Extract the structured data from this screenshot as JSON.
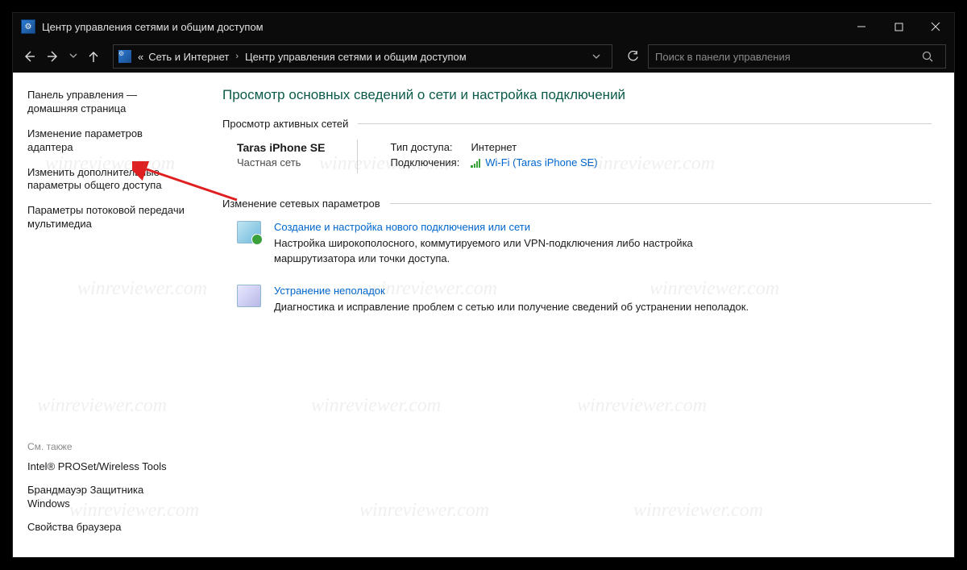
{
  "window": {
    "title": "Центр управления сетями и общим доступом"
  },
  "address": {
    "prefix": "«",
    "crumb1": "Сеть и Интернет",
    "crumb2": "Центр управления сетями и общим доступом"
  },
  "search": {
    "placeholder": "Поиск в панели управления"
  },
  "sidebar": {
    "home": "Панель управления — домашняя страница",
    "adapter": "Изменение параметров адаптера",
    "sharing": "Изменить дополнительные параметры общего доступа",
    "streaming": "Параметры потоковой передачи мультимедиа",
    "see_also_hdr": "См. также",
    "see_also_1": "Intel® PROSet/Wireless Tools",
    "see_also_2": "Брандмауэр Защитника Windows",
    "see_also_3": "Свойства браузера"
  },
  "main": {
    "heading": "Просмотр основных сведений о сети и настройка подключений",
    "view_active_hdr": "Просмотр активных сетей",
    "net": {
      "name": "Taras iPhone SE",
      "type": "Частная сеть",
      "access_label": "Тип доступа:",
      "access_value": "Интернет",
      "conn_label": "Подключения:",
      "conn_value": "Wi-Fi (Taras iPhone SE)"
    },
    "change_hdr": "Изменение сетевых параметров",
    "task1": {
      "title": "Создание и настройка нового подключения или сети",
      "desc": "Настройка широкополосного, коммутируемого или VPN-подключения либо настройка маршрутизатора или точки доступа."
    },
    "task2": {
      "title": "Устранение неполадок",
      "desc": "Диагностика и исправление проблем с сетью или получение сведений об устранении неполадок."
    }
  },
  "watermark": "winreviewer.com"
}
